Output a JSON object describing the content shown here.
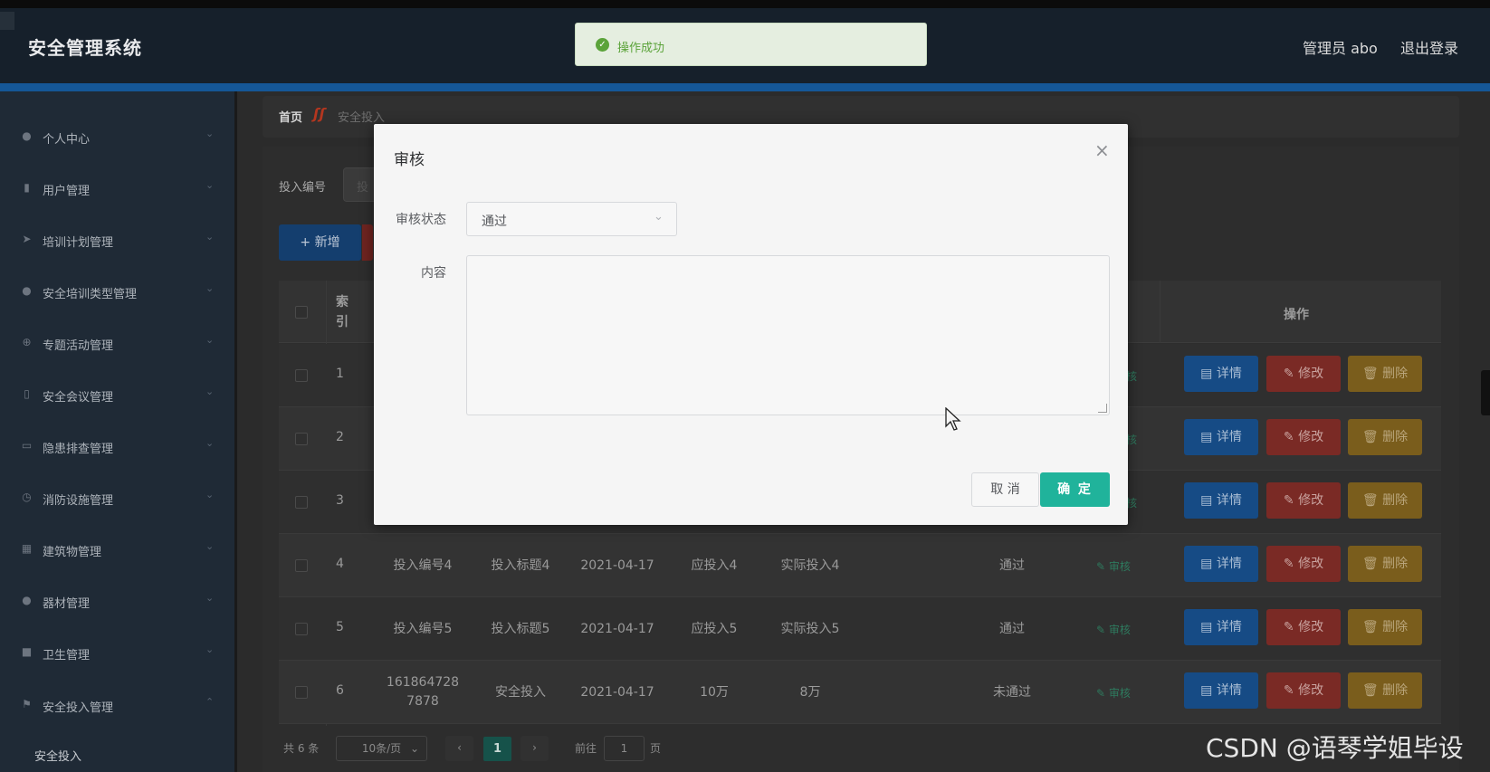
{
  "header": {
    "app_title": "安全管理系统",
    "user_label": "管理员 abo",
    "logout_label": "退出登录"
  },
  "toast": {
    "message": "操作成功",
    "icon": "check-circle-icon"
  },
  "sidebar": {
    "items": [
      {
        "label": "个人中心",
        "icon": "user-icon"
      },
      {
        "label": "用户管理",
        "icon": "mic-icon"
      },
      {
        "label": "培训计划管理",
        "icon": "send-icon"
      },
      {
        "label": "安全培训类型管理",
        "icon": "user-icon"
      },
      {
        "label": "专题活动管理",
        "icon": "compass-icon"
      },
      {
        "label": "安全会议管理",
        "icon": "mobile-icon"
      },
      {
        "label": "隐患排查管理",
        "icon": "message-icon"
      },
      {
        "label": "消防设施管理",
        "icon": "clock-icon"
      },
      {
        "label": "建筑物管理",
        "icon": "grid-icon"
      },
      {
        "label": "器材管理",
        "icon": "user-icon"
      },
      {
        "label": "卫生管理",
        "icon": "chat-icon"
      },
      {
        "label": "安全投入管理",
        "icon": "flag-icon"
      }
    ],
    "sub_item": "安全投入"
  },
  "breadcrumb": {
    "home": "首页",
    "separator": "ʃʃ",
    "current": "安全投入"
  },
  "search": {
    "label": "投入编号",
    "placeholder": "投"
  },
  "toolbar": {
    "add_label": "+ 新增"
  },
  "table": {
    "headers": {
      "index": "索\n引",
      "actions": "操作"
    },
    "rows": [
      {
        "index": "1",
        "code": "",
        "title": "",
        "date": "",
        "planned": "",
        "actual": "",
        "status": "",
        "audit": "核"
      },
      {
        "index": "2",
        "code": "",
        "title": "",
        "date": "",
        "planned": "",
        "actual": "",
        "status": "",
        "audit": "核"
      },
      {
        "index": "3",
        "code": "",
        "title": "",
        "date": "",
        "planned": "",
        "actual": "",
        "status": "",
        "audit": "核"
      },
      {
        "index": "4",
        "code": "投入编号4",
        "title": "投入标题4",
        "date": "2021-04-17",
        "planned": "应投入4",
        "actual": "实际投入4",
        "status": "通过",
        "audit": "审核"
      },
      {
        "index": "5",
        "code": "投入编号5",
        "title": "投入标题5",
        "date": "2021-04-17",
        "planned": "应投入5",
        "actual": "实际投入5",
        "status": "通过",
        "audit": "审核"
      },
      {
        "index": "6",
        "code": "161864728\n7878",
        "title": "安全投入",
        "date": "2021-04-17",
        "planned": "10万",
        "actual": "8万",
        "status": "未通过",
        "audit": "审核"
      }
    ],
    "row_actions": {
      "detail": "详情",
      "edit": "修改",
      "delete": "删除"
    }
  },
  "pagination": {
    "total": "共 6 条",
    "page_size": "10条/页",
    "current_page": "1",
    "goto_prefix": "前往",
    "goto_value": "1",
    "goto_suffix": "页"
  },
  "modal": {
    "title": "审核",
    "status_label": "审核状态",
    "status_value": "通过",
    "content_label": "内容",
    "content_value": "",
    "cancel_label": "取 消",
    "confirm_label": "确 定"
  },
  "watermark": "CSDN @语琴学姐毕设",
  "colors": {
    "header_bg": "#16202b",
    "accent_blue": "#155797",
    "success_green": "#5ba33a",
    "confirm_teal": "#20b39b"
  }
}
